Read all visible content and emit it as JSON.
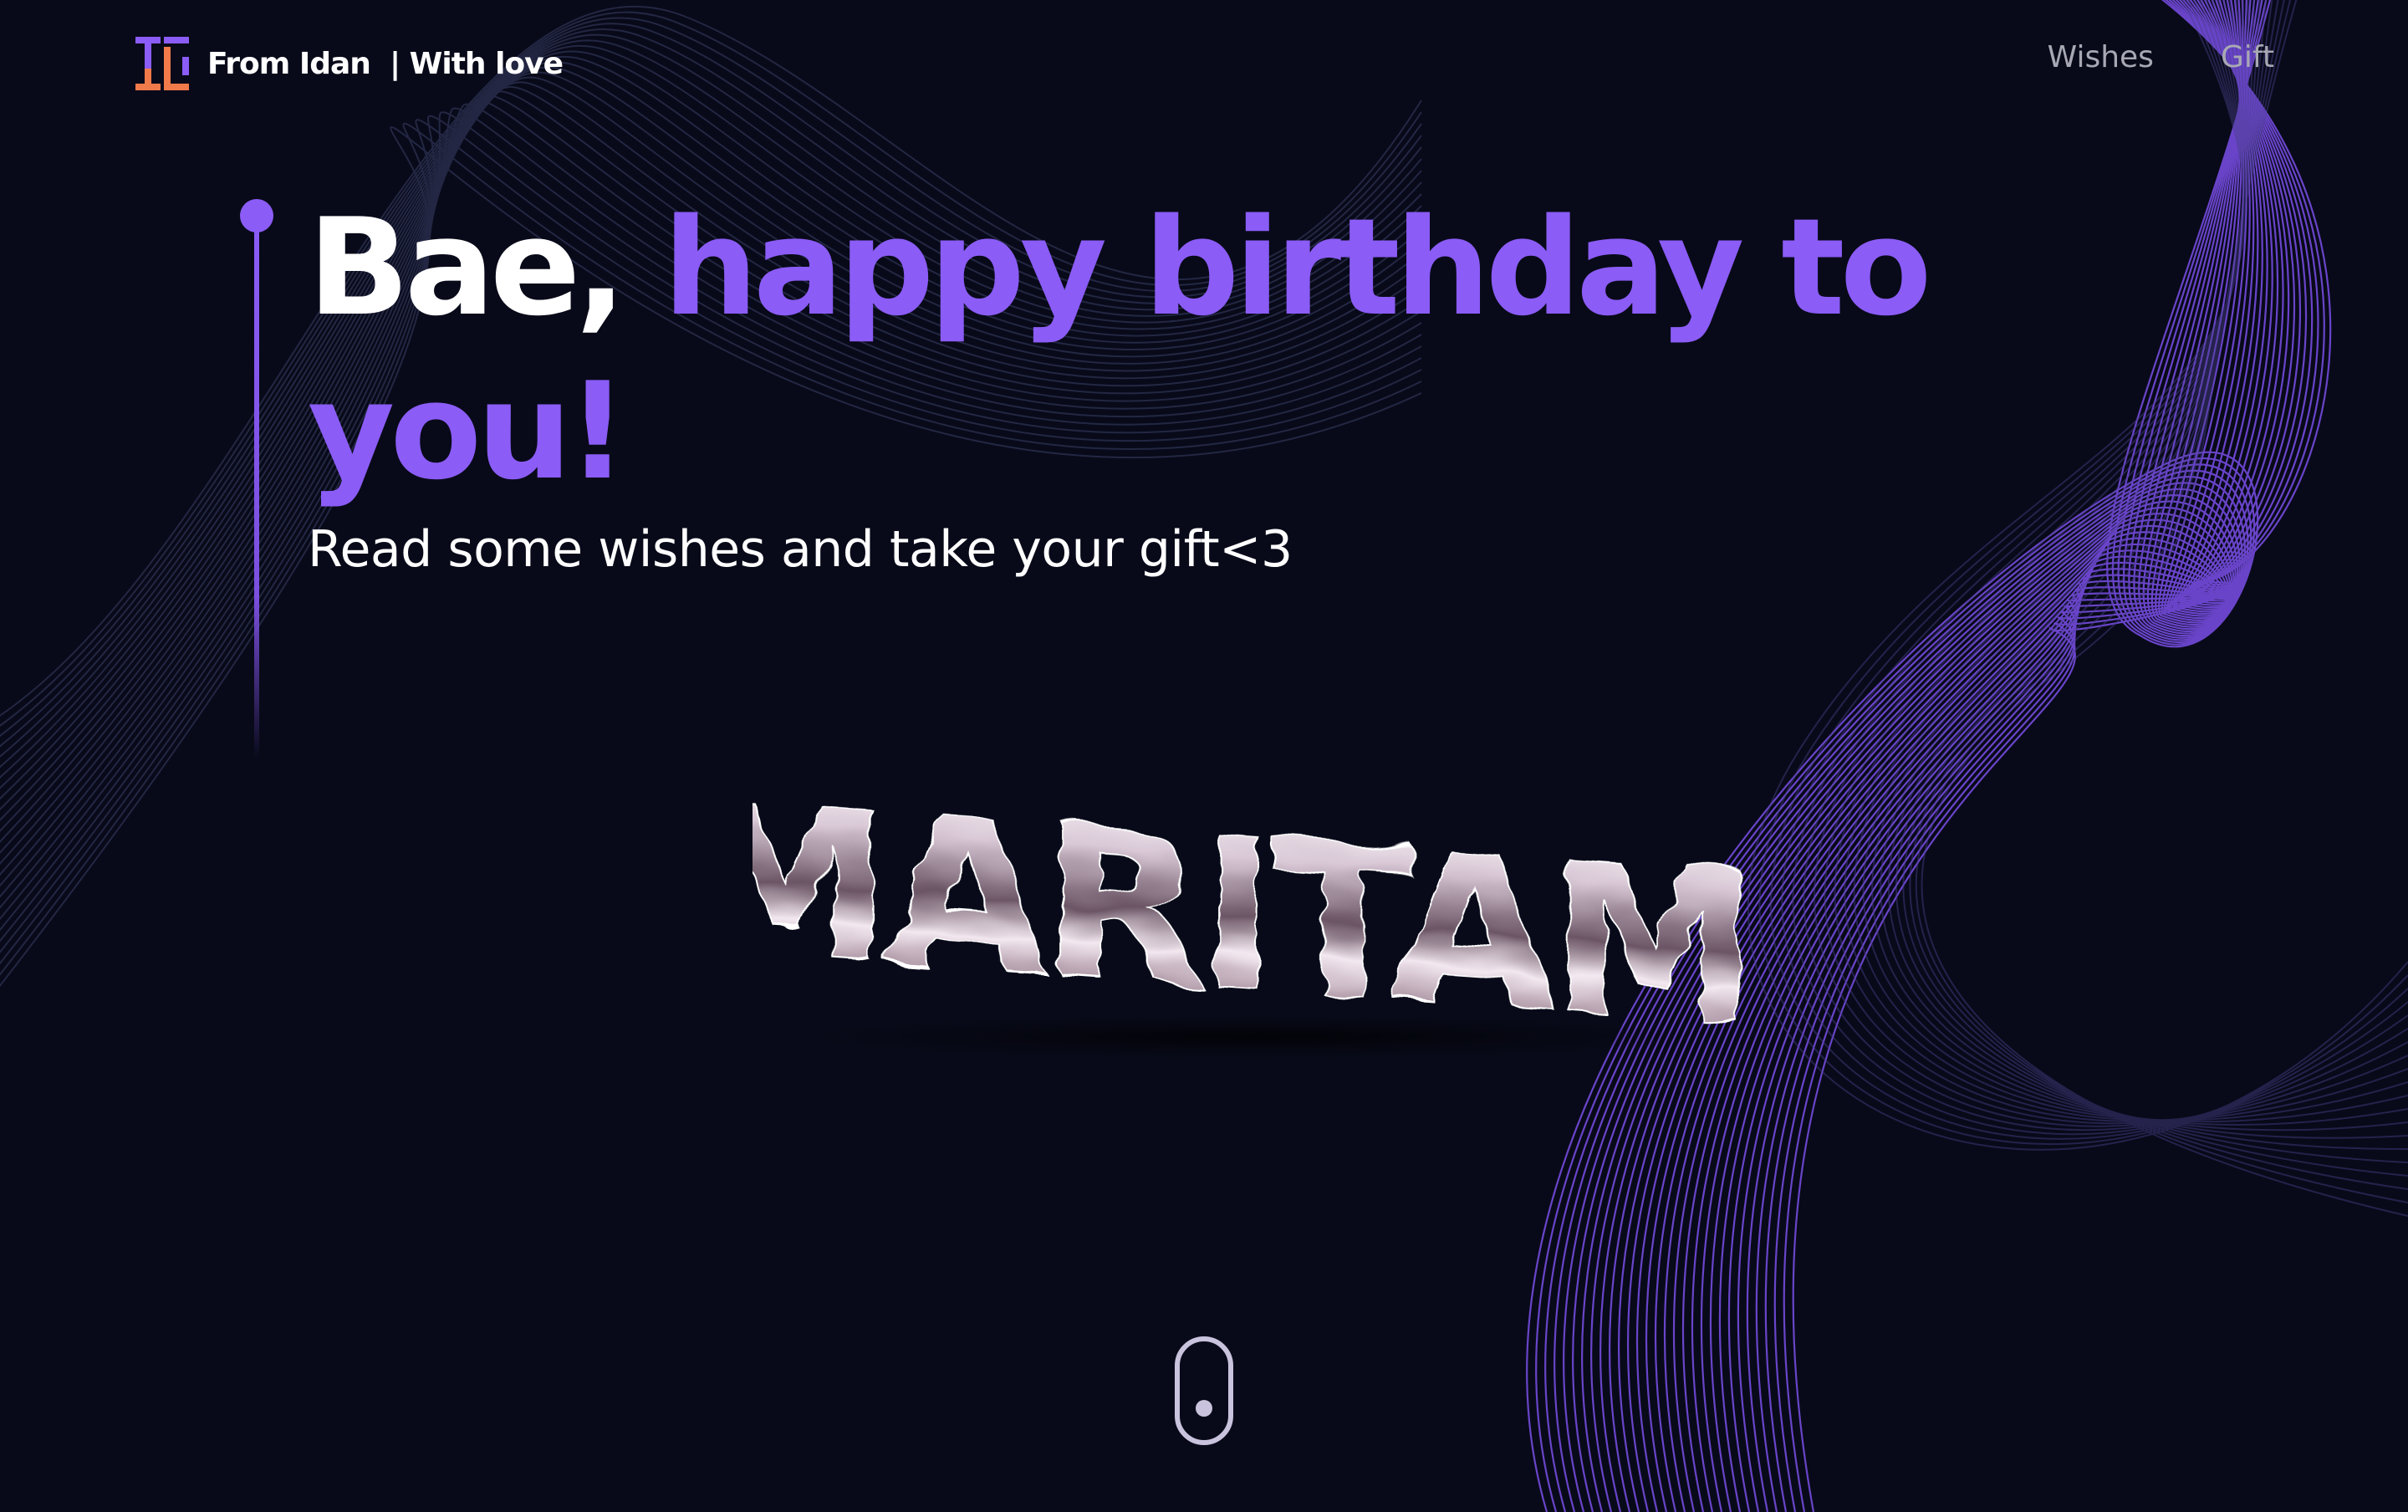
{
  "brand": {
    "text": "From Idan  | With love",
    "logo_colors": [
      "#8b5cf6",
      "#f07a4a"
    ]
  },
  "nav": {
    "items": [
      {
        "label": "Wishes"
      },
      {
        "label": "Gift"
      }
    ]
  },
  "hero": {
    "title_white": "Bae, ",
    "title_accent": "happy birthday to you!",
    "subtitle": "Read some wishes and take your gift<3",
    "art_text": "MARITAMI"
  },
  "colors": {
    "background": "#080a19",
    "accent": "#8b5cf6",
    "nav_text": "#a8a8b4",
    "scroll_indicator": "#c9c3dd"
  },
  "icons": {
    "brand": "brand-logo-icon",
    "scroll": "mouse-scroll-icon"
  }
}
